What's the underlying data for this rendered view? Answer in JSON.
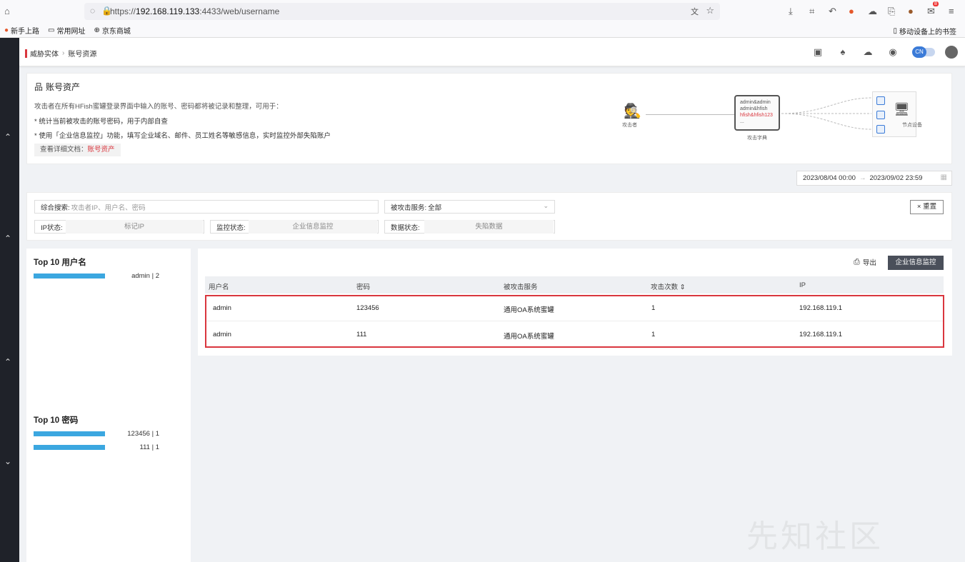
{
  "browser": {
    "url_prefix": "https://",
    "url_host": "192.168.119.133",
    "url_rest": ":4433/web/username",
    "bookmarks": [
      {
        "label": "新手上路"
      },
      {
        "label": "常用网址"
      },
      {
        "label": "京东商城"
      }
    ],
    "mobile_bookmarks": "移动设备上的书签",
    "notification_count": "8"
  },
  "header": {
    "breadcrumb_parent": "威胁实体",
    "breadcrumb_current": "账号资源",
    "lang_toggle": "CN"
  },
  "info": {
    "title": "账号资产",
    "description": "攻击者在所有HFish蜜罐登录界面中输入的账号、密码都将被记录和整理，可用于：",
    "bullet_1": "* 统计当前被攻击的账号密码，用于内部自查",
    "bullet_2": "* 使用「企业信息监控」功能，填写企业域名、邮件、员工姓名等敏感信息，实时监控外部失陷账户",
    "doc_label": "查看详细文档：",
    "doc_link": "账号资产"
  },
  "diagram": {
    "attacker_label": "攻击者",
    "dict_lines": [
      "admin&admin",
      "admin&hfish",
      "hfish&hfish123",
      "..."
    ],
    "dict_label": "攻击字典",
    "node_label": "节点设备"
  },
  "date_range": {
    "start": "2023/08/04 00:00",
    "end": "2023/09/02 23:59"
  },
  "filters": {
    "search_label": "综合搜索:",
    "search_placeholder": "攻击者IP、用户名、密码",
    "service_label": "被攻击服务:",
    "service_value": "全部",
    "ip_status_label": "IP状态:",
    "ip_status_value": "标记IP",
    "monitor_status_label": "监控状态:",
    "monitor_status_value": "企业信息监控",
    "data_status_label": "数据状态:",
    "data_status_value": "失陷数据",
    "reset_label": "× 重置"
  },
  "stats": {
    "top_usernames_title": "Top 10 用户名",
    "top_usernames": [
      {
        "name": "admin",
        "count": "2",
        "fraction": 1.0
      }
    ],
    "top_passwords_title": "Top 10 密码",
    "top_passwords": [
      {
        "name": "123456",
        "count": "1",
        "fraction": 1.0
      },
      {
        "name": "111",
        "count": "1",
        "fraction": 1.0
      }
    ]
  },
  "table": {
    "export_label": "导出",
    "monitor_button": "企业信息监控",
    "columns": [
      "用户名",
      "密码",
      "被攻击服务",
      "攻击次数 ⇕",
      "IP"
    ],
    "rows": [
      [
        "admin",
        "123456",
        "通用OA系统蜜罐",
        "1",
        "192.168.119.1"
      ],
      [
        "admin",
        "111",
        "通用OA系统蜜罐",
        "1",
        "192.168.119.1"
      ]
    ]
  },
  "watermark": "先知社区",
  "colors": {
    "accent_red": "#d9363e",
    "bar_blue": "#3ba7e0",
    "sidebar_dark": "#1f2229",
    "button_dark": "#4a4f5a"
  }
}
